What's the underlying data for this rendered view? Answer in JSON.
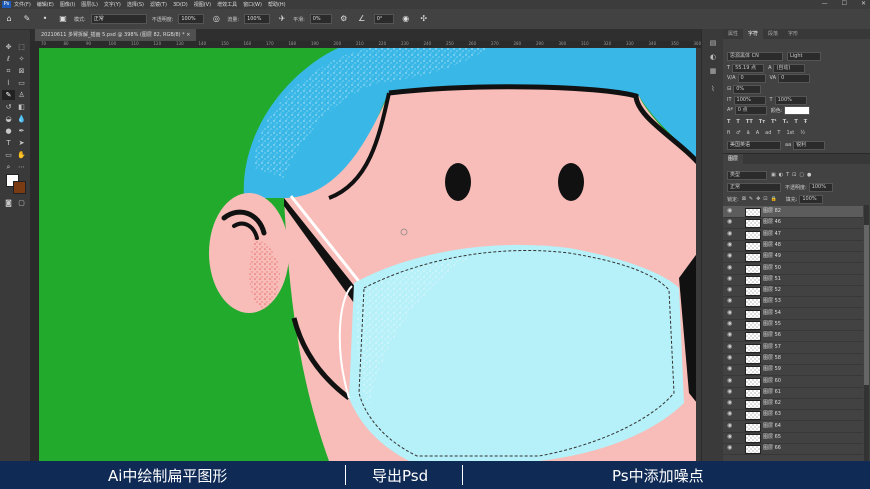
{
  "menubar": {
    "logo": "Ps",
    "items": [
      "文件(F)",
      "编辑(E)",
      "图像(I)",
      "图层(L)",
      "文字(Y)",
      "选择(S)",
      "滤镜(T)",
      "3D(D)",
      "视图(V)",
      "增效工具",
      "窗口(W)",
      "帮助(H)"
    ],
    "window_controls": [
      "—",
      "☐",
      "✕"
    ]
  },
  "options_bar": {
    "mode_label": "模式:",
    "mode_value": "正常",
    "opacity_label": "不透明度:",
    "opacity_value": "100%",
    "flow_label": "流量:",
    "flow_value": "100%",
    "smoothing_label": "平滑:",
    "smoothing_value": "0%",
    "angle_value": "0°"
  },
  "document_tab": {
    "title": "20210611 多臂拆解_插画 5.psd @ 398% (图层 82, RGB/8) *",
    "close": "×"
  },
  "ruler": {
    "top_ticks": [
      "70",
      "80",
      "90",
      "100",
      "110",
      "120",
      "130",
      "140",
      "150",
      "160",
      "170",
      "180",
      "190",
      "200",
      "210",
      "220",
      "230",
      "240",
      "250",
      "260",
      "270",
      "280",
      "290",
      "300",
      "310",
      "320",
      "330",
      "340",
      "350",
      "360"
    ]
  },
  "character_panel": {
    "tabs": [
      "属性",
      "字符",
      "段落",
      "字形"
    ],
    "active_tab": "字符",
    "font_family": "思源黑体 CN",
    "font_style": "Light",
    "font_size": "55.19 点",
    "leading": "(自动)",
    "kerning": "0",
    "tracking": "0",
    "vertical_scale": "100%",
    "horizontal_scale": "100%",
    "baseline_shift": "0 点",
    "color_label": "颜色:",
    "language": "美国英语",
    "antialias": "锐利",
    "percent_small": "0%"
  },
  "layers_panel": {
    "tabs": [
      "图层"
    ],
    "filter_label": "类型",
    "blend_mode": "正常",
    "opacity_label": "不透明度:",
    "opacity_value": "100%",
    "lock_label": "锁定:",
    "fill_label": "填充:",
    "fill_value": "100%",
    "rows": [
      "图层 82",
      "图层 46",
      "图层 47",
      "图层 48",
      "图层 49",
      "图层 50",
      "图层 51",
      "图层 52",
      "图层 53",
      "图层 54",
      "图层 55",
      "图层 56",
      "图层 57",
      "图层 58",
      "图层 59",
      "图层 60",
      "图层 61",
      "图层 62",
      "图层 63",
      "图层 64",
      "图层 65",
      "图层 66"
    ],
    "selected_index": 0
  },
  "subtitles": {
    "left": "Ai中绘制扁平图形",
    "middle": "导出Psd",
    "right": "Ps中添加噪点"
  },
  "colors": {
    "canvas_bg": "#22aa2c",
    "hair": "#39b8e8",
    "skin": "#f8bdb8",
    "mask": "#b6f0f8",
    "outline": "#111111",
    "subtitle_bar": "#0f2a55"
  }
}
